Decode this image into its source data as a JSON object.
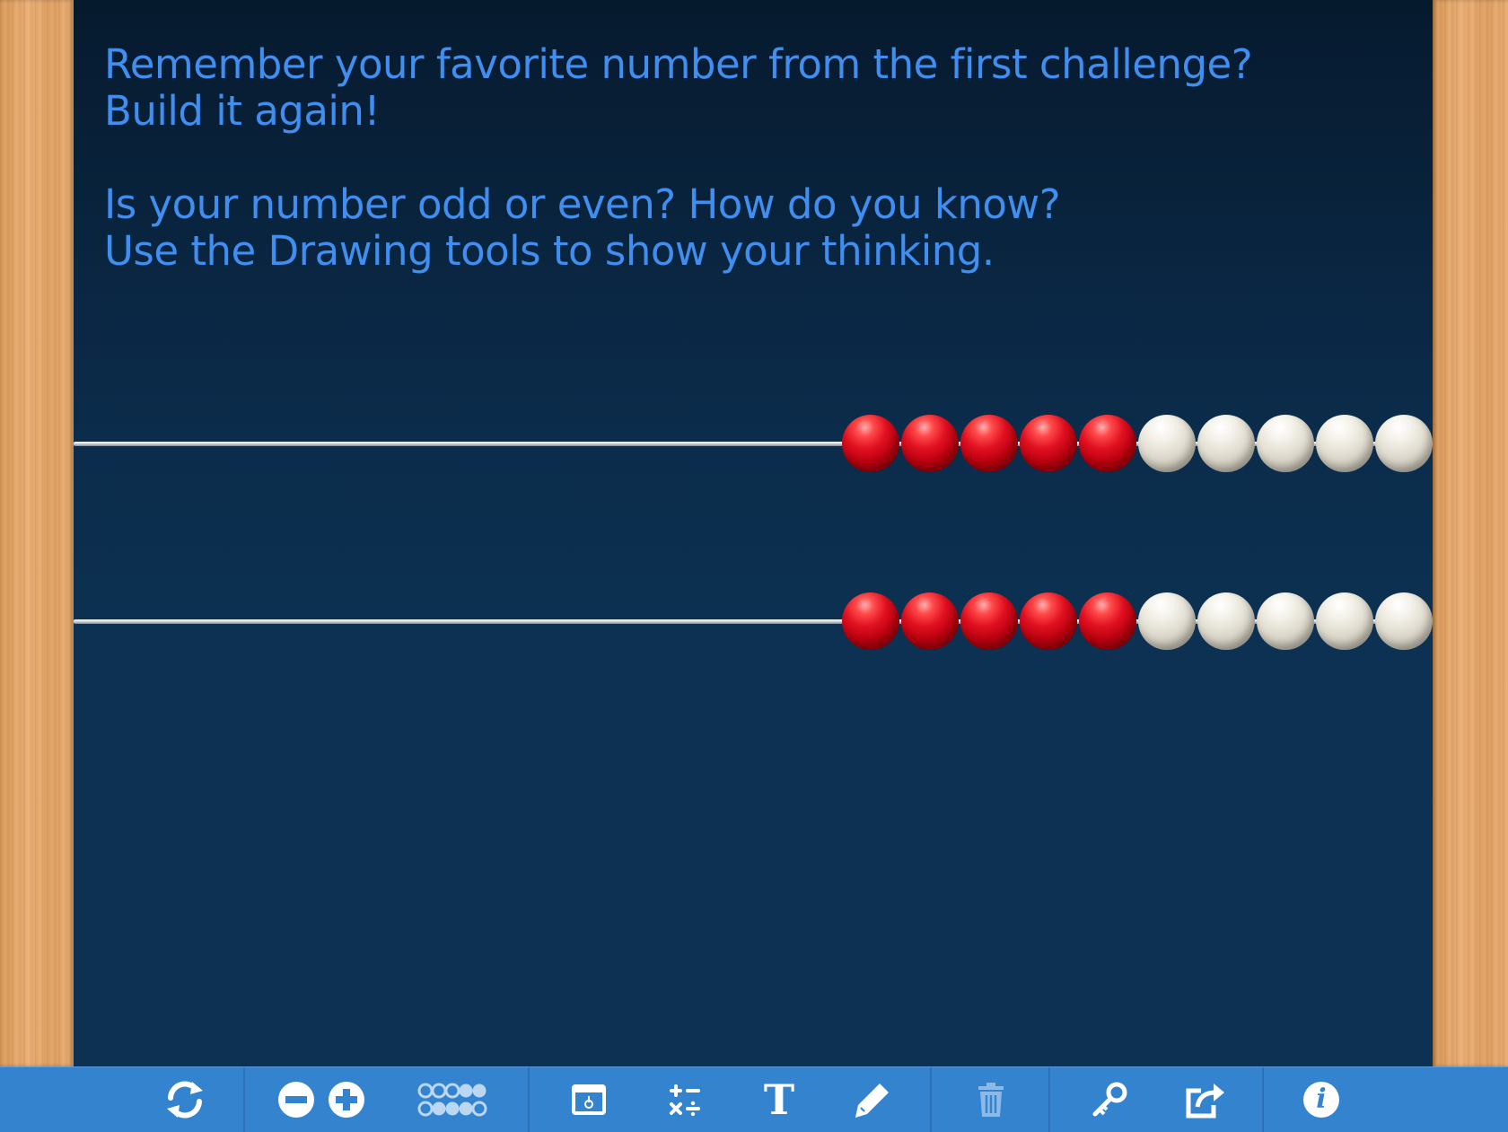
{
  "prompt": {
    "line1": "Remember your favorite number from the first challenge?",
    "line2": "Build it again!",
    "line3": "Is your number odd or even? How do you know?",
    "line4": "Use the Drawing tools to show your thinking."
  },
  "rekenrek": {
    "rows": [
      {
        "red_beads": 5,
        "white_beads": 5
      },
      {
        "red_beads": 5,
        "white_beads": 5
      }
    ]
  },
  "colors": {
    "prompt_text": "#3f8ef0",
    "board": "#0c3152",
    "toolbar": "#3383cf",
    "bead_red": "#e01020",
    "bead_white": "#e2ded2",
    "frame_wood": "#e3a66b"
  },
  "toolbar": {
    "tools": [
      {
        "icon": "reset-icon"
      },
      {
        "icon": "remove-row-icon"
      },
      {
        "icon": "add-row-icon"
      },
      {
        "icon": "bead-layout-icon"
      },
      {
        "icon": "cover-icon"
      },
      {
        "icon": "operations-icon"
      },
      {
        "icon": "text-tool-icon",
        "glyph": "T"
      },
      {
        "icon": "pencil-icon"
      },
      {
        "icon": "trash-icon"
      },
      {
        "icon": "key-icon"
      },
      {
        "icon": "share-icon"
      },
      {
        "icon": "info-icon",
        "glyph": "i"
      }
    ]
  }
}
